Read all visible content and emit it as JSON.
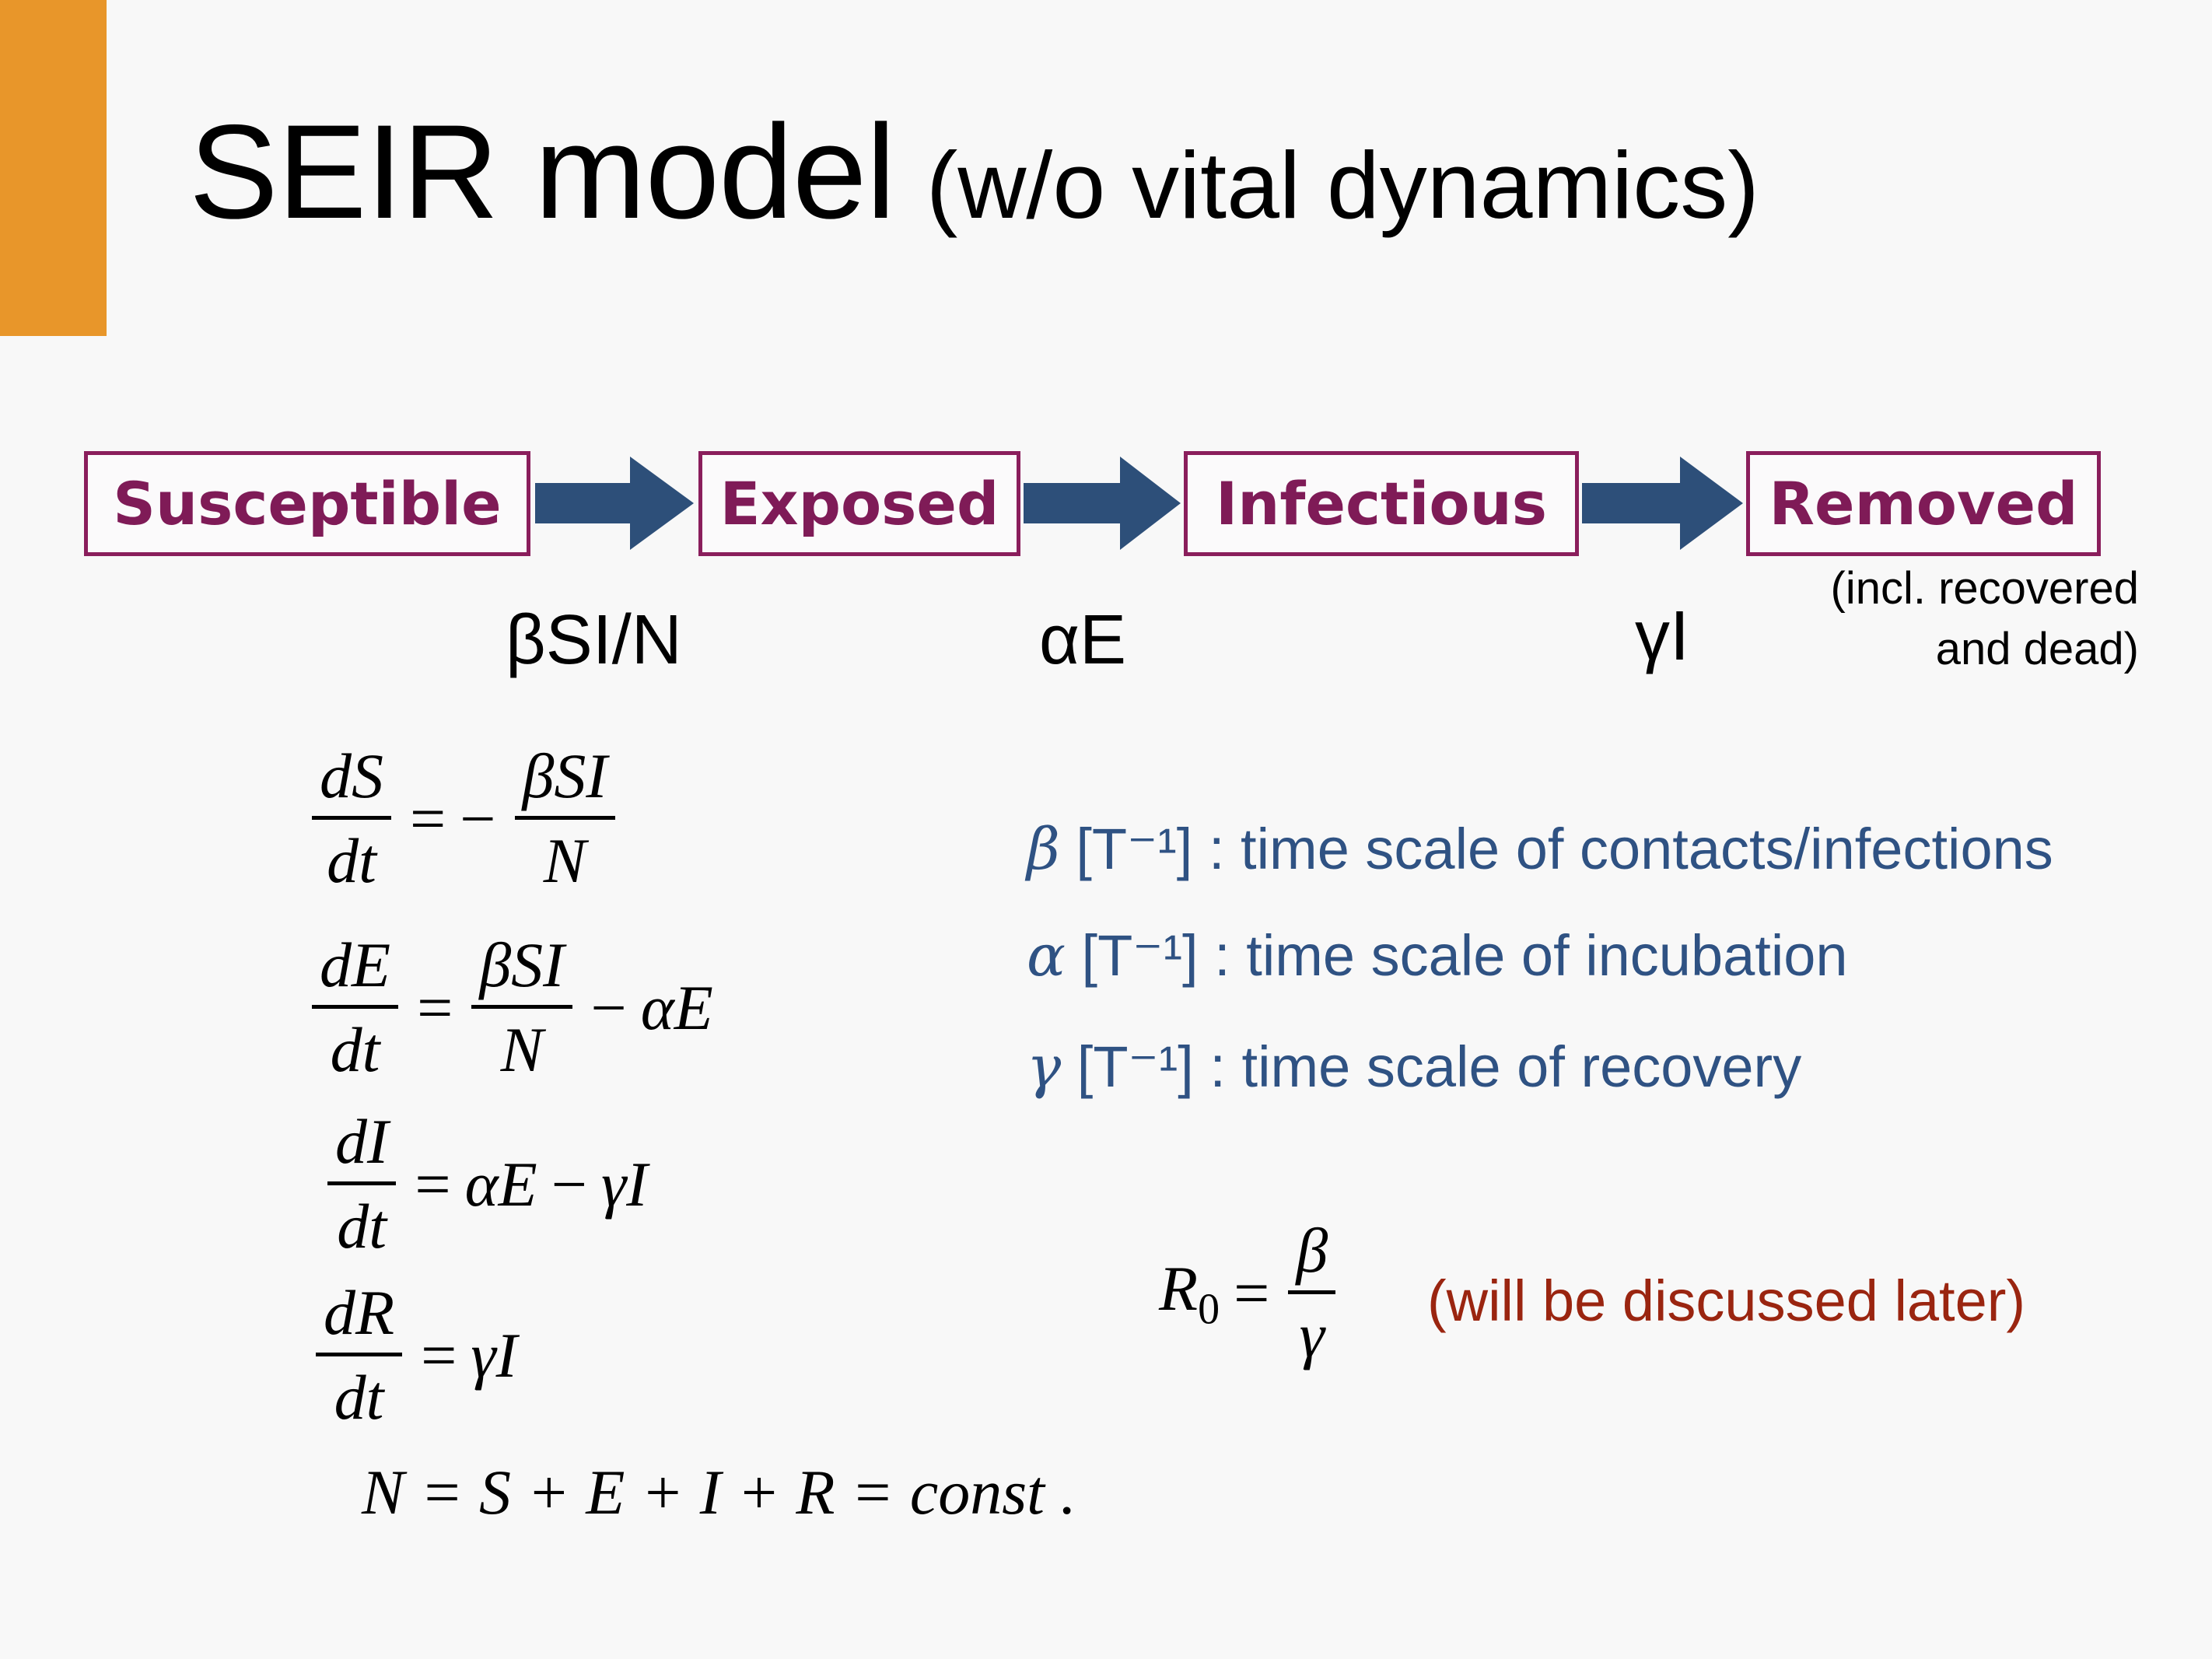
{
  "colors": {
    "accent_bar": "#e8962a",
    "box_border": "#8a1e5c",
    "box_text": "#7f1b57",
    "arrow": "#2d4f79",
    "legend_text": "#2f5283",
    "later_text": "#9a2510"
  },
  "title": {
    "main": "SEIR model",
    "sub": "(w/o vital dynamics)"
  },
  "compartments": [
    "Susceptible",
    "Exposed",
    "Infectious",
    "Removed"
  ],
  "rates": [
    "βSI/N",
    "αE",
    "γI"
  ],
  "removed_note": [
    "(incl. recovered",
    "and dead)"
  ],
  "equations": {
    "dS": "dS",
    "dE": "dE",
    "dI": "dI",
    "dR": "dR",
    "dt": "dt",
    "eq": "=",
    "minus": "−",
    "plus": "+",
    "betaSI": "βSI",
    "N": "N",
    "alphaE": "αE",
    "gammaI": "γI",
    "N_sum": "N = S + E + I + R = const ."
  },
  "legend": [
    {
      "symbol": "β",
      "unit": "[T⁻¹]",
      "desc": ": time scale of contacts/infections"
    },
    {
      "symbol": "α",
      "unit": "[T⁻¹]",
      "desc": ": time scale of incubation"
    },
    {
      "symbol": "γ",
      "unit": "[T⁻¹]",
      "desc": ": time scale of recovery"
    }
  ],
  "r0": {
    "R": "R",
    "sub": "0",
    "eq": "=",
    "num": "β",
    "den": "γ",
    "note": "(will be discussed later)"
  }
}
